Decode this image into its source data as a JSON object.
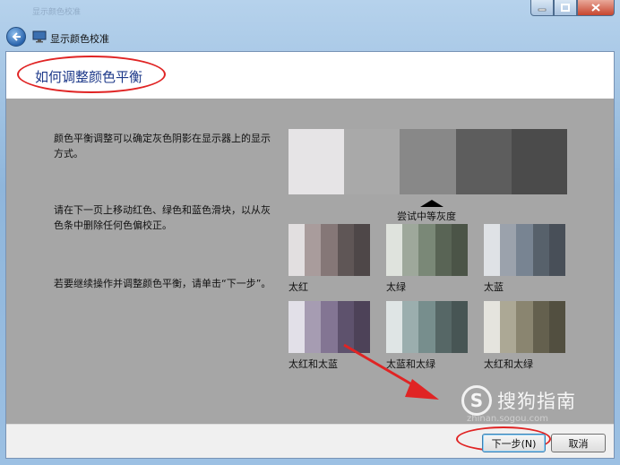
{
  "window": {
    "title": "显示颜色校准",
    "ghost_title": "显示颜色校准",
    "controls": [
      "minimize",
      "maximize",
      "close"
    ]
  },
  "header": {
    "title": "如何调整颜色平衡"
  },
  "instructions": [
    "颜色平衡调整可以确定灰色阴影在显示器上的显示方式。",
    "请在下一页上移动红色、绿色和蓝色滑块，以从灰色条中删除任何色偏校正。",
    "若要继续操作并调整颜色平衡，请单击“下一步”。"
  ],
  "gradient_bar": {
    "colors": [
      "#e6e4e6",
      "#a9a9a9",
      "#888888",
      "#5d5d5d",
      "#4b4b4b"
    ],
    "label": "尝试中等灰度"
  },
  "swatches": [
    {
      "label": "太红",
      "colors": [
        "#e2dfe0",
        "#a99c9c",
        "#857777",
        "#5f5656",
        "#4e4748"
      ]
    },
    {
      "label": "太绿",
      "colors": [
        "#dfe3dd",
        "#9ea89b",
        "#7a8877",
        "#596455",
        "#4b5447"
      ]
    },
    {
      "label": "太蓝",
      "colors": [
        "#dfe2e6",
        "#9ba2ac",
        "#788492",
        "#57616b",
        "#484f58"
      ]
    },
    {
      "label": "太红和太蓝",
      "colors": [
        "#e2e0e8",
        "#a69cb2",
        "#837593",
        "#5e526d",
        "#4d4258"
      ]
    },
    {
      "label": "太蓝和太绿",
      "colors": [
        "#dfe5e5",
        "#9baeae",
        "#778e8d",
        "#566766",
        "#475554"
      ]
    },
    {
      "label": "太红和太绿",
      "colors": [
        "#e5e4de",
        "#aca895",
        "#8a8570",
        "#64604e",
        "#524f40"
      ]
    }
  ],
  "watermark": {
    "logo": "S",
    "text": "搜狗指南",
    "url": "zhinan.sogou.com"
  },
  "footer": {
    "next_label": "下一步(N)",
    "cancel_label": "取消"
  },
  "annotations": {
    "color": "#e02424"
  }
}
